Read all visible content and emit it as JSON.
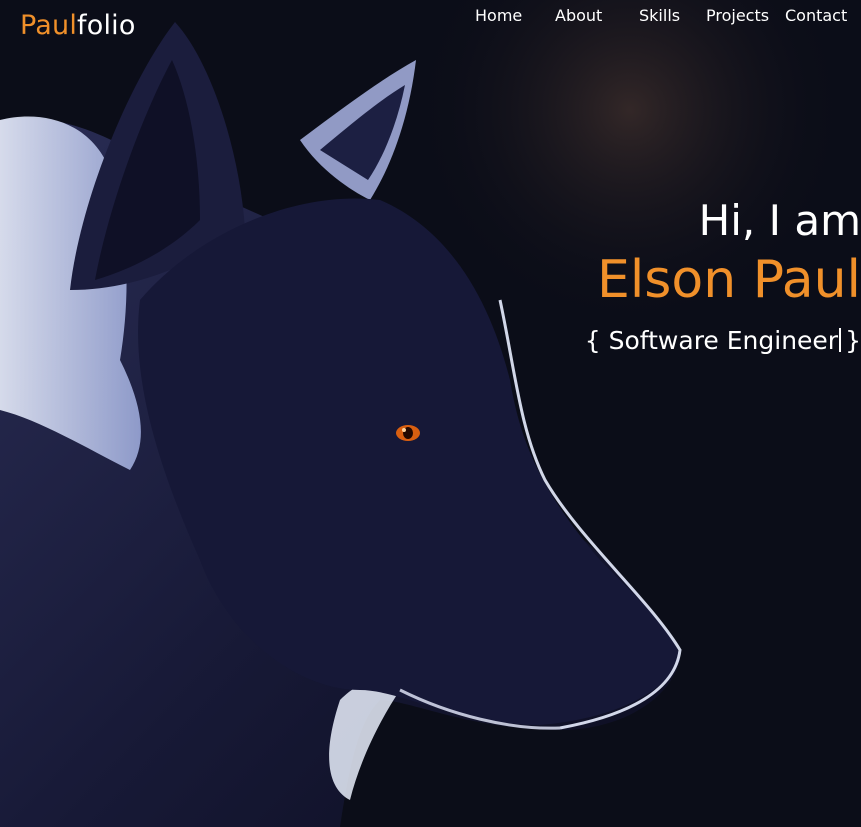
{
  "brand": {
    "part1": "Paul",
    "part2": "folio"
  },
  "nav": {
    "home": "Home",
    "about": "About",
    "skills": "Skills",
    "projects": "Projects",
    "contact": "Contact"
  },
  "hero": {
    "greeting": "Hi, I am",
    "name": "Elson Paul",
    "role_open": "{",
    "role": "Software Engineer",
    "role_close": "}"
  },
  "colors": {
    "accent": "#f0902a",
    "text": "#ffffff",
    "background": "#0b0d18"
  },
  "icons": {
    "hero_image": "wolf-illustration"
  }
}
